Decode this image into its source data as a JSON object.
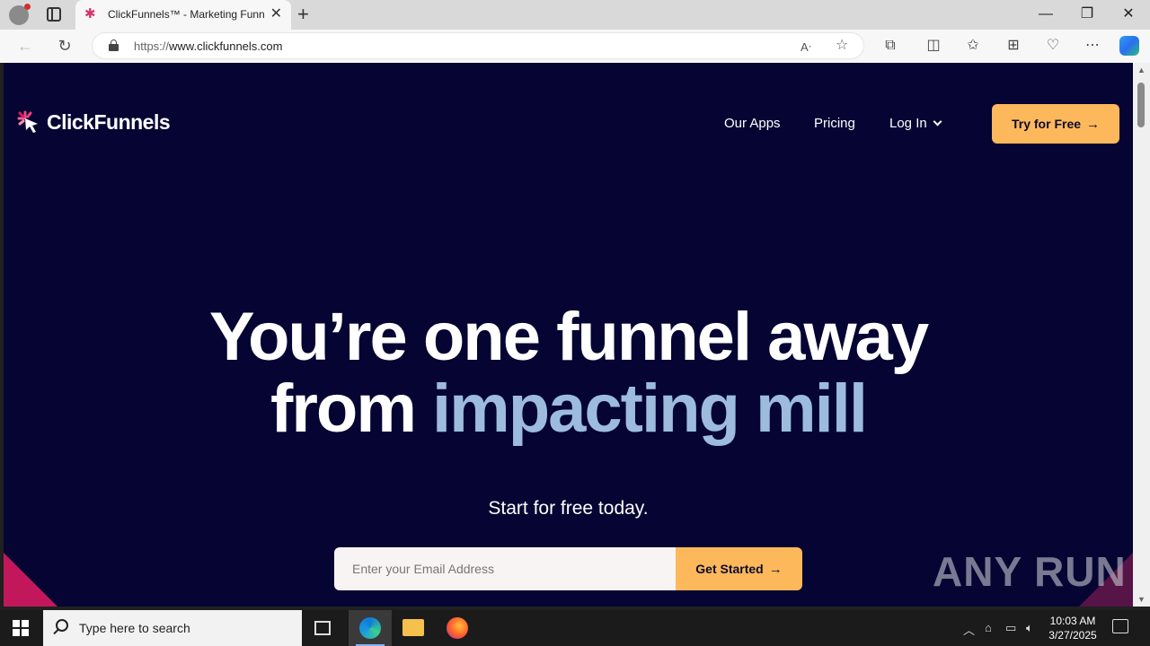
{
  "browser": {
    "tab_title": "ClickFunnels™ - Marketing Funn",
    "url_prefix": "https://",
    "url_host": "www.clickfunnels.com"
  },
  "site": {
    "logo_text": "ClickFunnels",
    "nav": {
      "our_apps": "Our Apps",
      "pricing": "Pricing",
      "log_in": "Log In",
      "try_free": "Try for Free"
    },
    "headline_line1": "You’re one funnel away",
    "headline_line2_plain": "from ",
    "headline_line2_accent": "impacting mill",
    "subheadline": "Start for free today.",
    "email_placeholder": "Enter your Email Address",
    "get_started": "Get Started",
    "colors": {
      "background": "#050433",
      "cta": "#fdb85c",
      "accent_text": "#9dbcdd"
    }
  },
  "watermark": "ANY RUN",
  "taskbar": {
    "search_placeholder": "Type here to search",
    "time": "10:03 AM",
    "date": "3/27/2025"
  }
}
